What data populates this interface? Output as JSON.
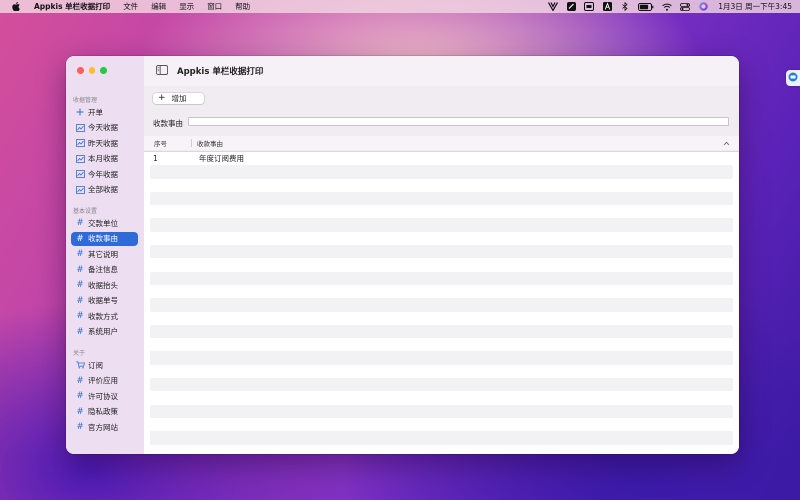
{
  "menubar": {
    "app_name": "Appkis 单栏收据打印",
    "items": [
      "文件",
      "编辑",
      "显示",
      "窗口",
      "帮助"
    ],
    "battery_level": 80,
    "clock": "1月3日 周一下午3:45"
  },
  "window": {
    "title": "Appkis 单栏收据打印"
  },
  "sidebar": {
    "sections": [
      {
        "title": "收据管理",
        "items": [
          {
            "label": "开单",
            "icon": "plus-icon"
          },
          {
            "label": "今天收据",
            "icon": "chart-icon"
          },
          {
            "label": "昨天收据",
            "icon": "chart-icon"
          },
          {
            "label": "本月收据",
            "icon": "chart-icon"
          },
          {
            "label": "今年收据",
            "icon": "chart-icon"
          },
          {
            "label": "全部收据",
            "icon": "chart-icon"
          }
        ]
      },
      {
        "title": "基本设置",
        "items": [
          {
            "label": "交款单位",
            "icon": "hash-icon"
          },
          {
            "label": "收款事由",
            "icon": "hash-icon",
            "selected": true
          },
          {
            "label": "其它说明",
            "icon": "hash-icon"
          },
          {
            "label": "备注信息",
            "icon": "hash-icon"
          },
          {
            "label": "收据抬头",
            "icon": "hash-icon"
          },
          {
            "label": "收据单号",
            "icon": "hash-icon"
          },
          {
            "label": "收款方式",
            "icon": "hash-icon"
          },
          {
            "label": "系统用户",
            "icon": "hash-icon"
          }
        ]
      },
      {
        "title": "关于",
        "items": [
          {
            "label": "订阅",
            "icon": "cart-icon"
          },
          {
            "label": "评价应用",
            "icon": "hash-icon"
          },
          {
            "label": "许可协议",
            "icon": "hash-icon"
          },
          {
            "label": "隐私政策",
            "icon": "hash-icon"
          },
          {
            "label": "官方网站",
            "icon": "hash-icon"
          }
        ]
      }
    ]
  },
  "toolbar": {
    "add_label": "增加",
    "field_label": "收款事由",
    "field_value": ""
  },
  "table": {
    "columns": [
      "序号",
      "收款事由"
    ],
    "rows": [
      {
        "seq": "1",
        "reason": "年度订阅费用"
      }
    ],
    "total_row_slots": 22
  },
  "colors": {
    "accent": "#2e6ad8",
    "close": "#fe5f57",
    "minimize": "#febc2e",
    "maximize": "#28c840"
  }
}
